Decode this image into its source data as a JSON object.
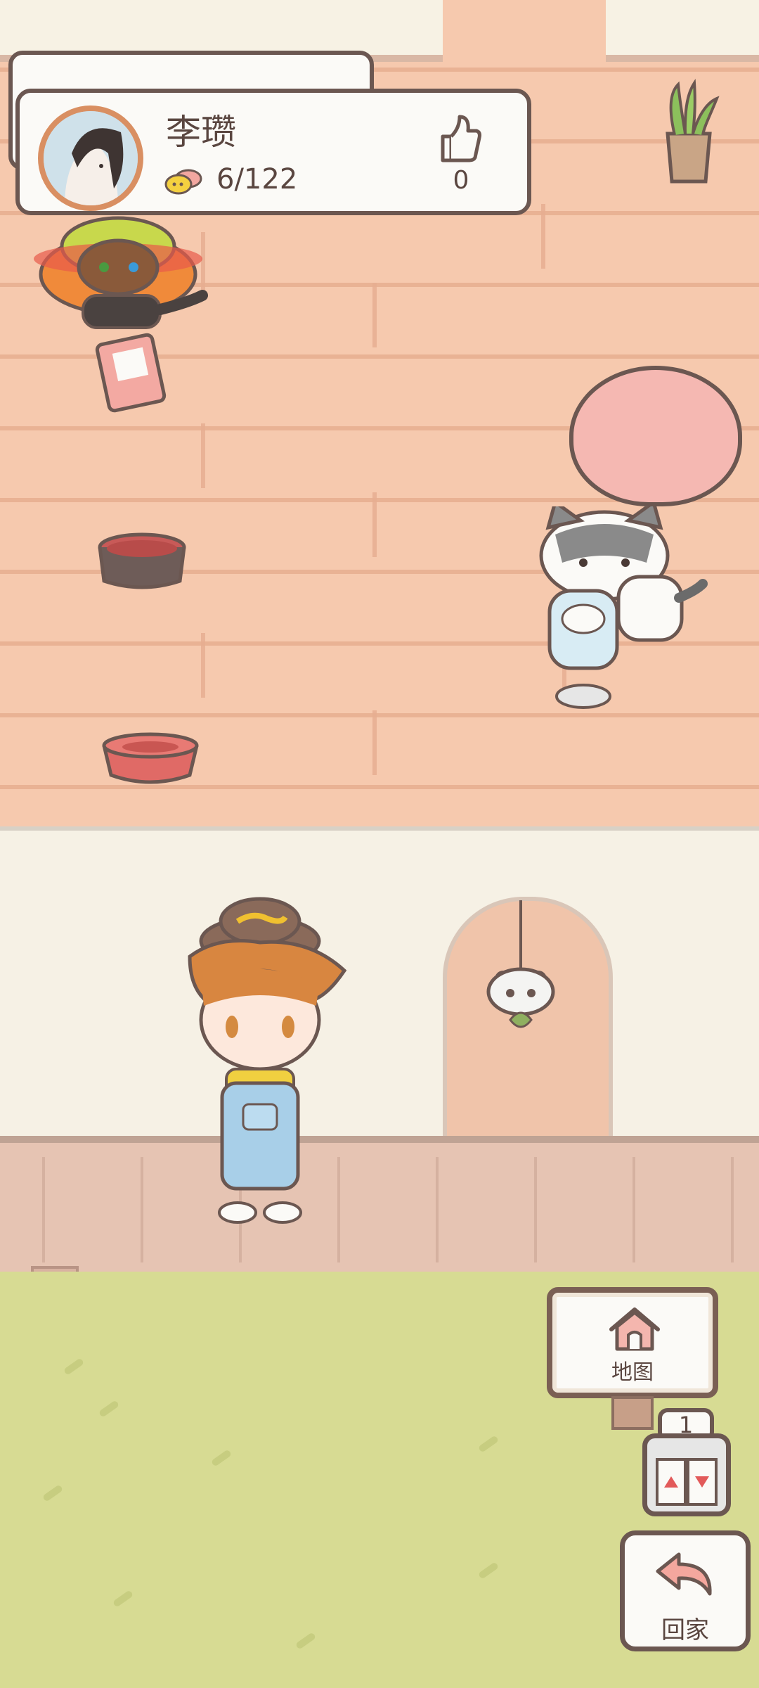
{
  "profile": {
    "name": "李瓒",
    "fish_count": "6/122",
    "likes": "0"
  },
  "navigation": {
    "map_label": "地图",
    "floor_number": "1",
    "home_label": "回家"
  },
  "colors": {
    "outline": "#6b5751",
    "plank": "#f6c9ae",
    "wall": "#f6f1e5",
    "grass": "#d7db93",
    "accent_pink": "#f5b8b2"
  },
  "icons": [
    "like-icon",
    "fish-icon",
    "house-icon",
    "elevator-icon",
    "return-arrow-icon"
  ]
}
